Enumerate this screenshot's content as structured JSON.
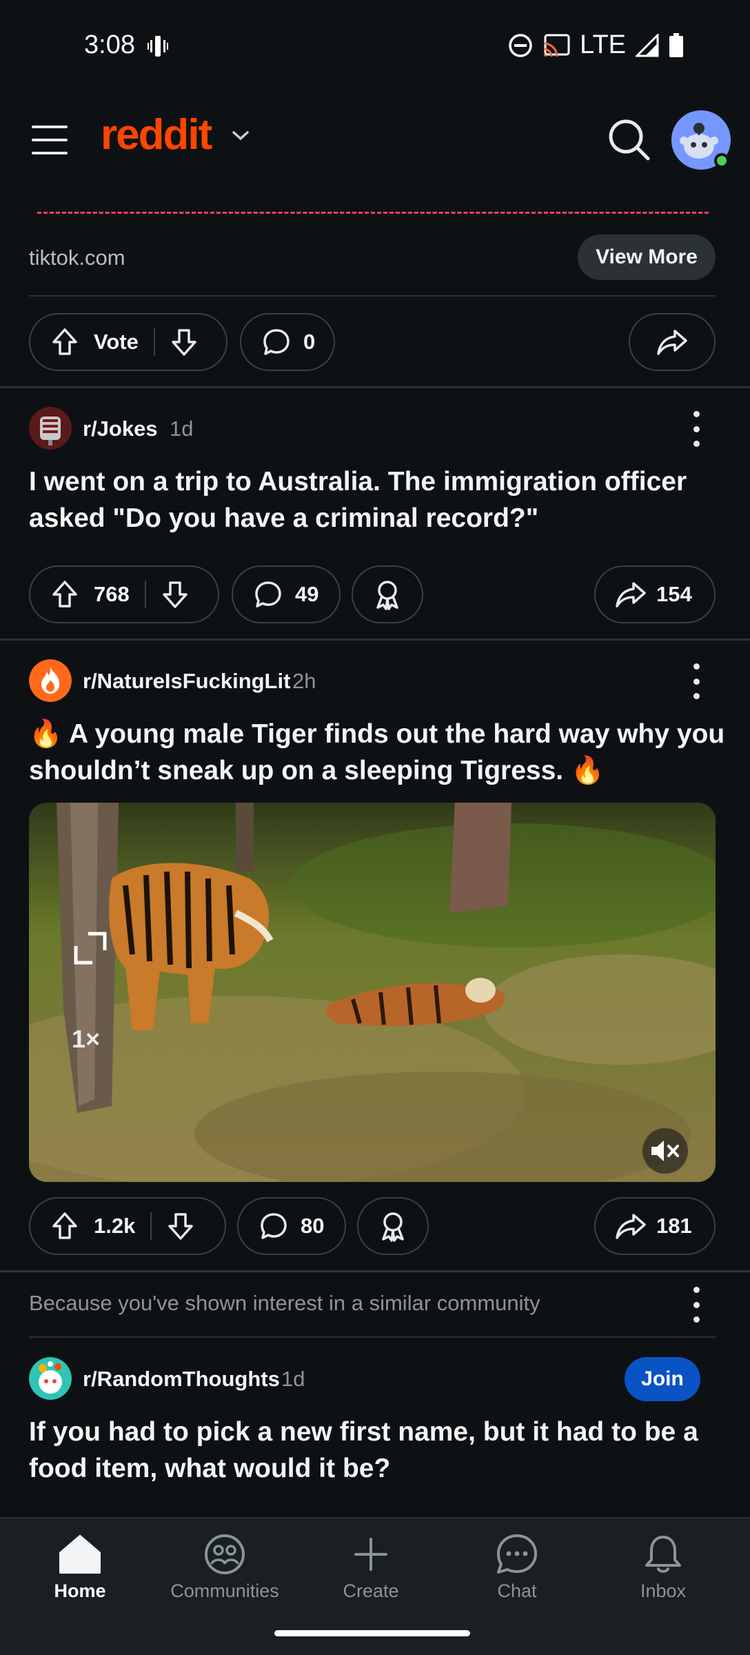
{
  "status_bar": {
    "time": "3:08",
    "network": "LTE",
    "icons": [
      "vibrate-icon",
      "dnd-icon",
      "cast-icon",
      "signal-icon",
      "battery-icon"
    ]
  },
  "header": {
    "logo": "reddit",
    "icons": [
      "menu-icon",
      "chevron-down-icon",
      "search-icon",
      "avatar"
    ]
  },
  "promo_card": {
    "domain": "tiktok.com",
    "view_more": "View More",
    "vote_label": "Vote",
    "comments": "0"
  },
  "posts": [
    {
      "subreddit": "r/Jokes",
      "age": "1d",
      "title": "I went on a trip to Australia. The immigration officer asked \"Do you have a criminal record?\"",
      "upvotes": "768",
      "comments": "49",
      "shares": "154"
    },
    {
      "subreddit": "r/NatureIsFuckingLit",
      "age": "2h",
      "title": "🔥 A young male Tiger finds out the hard way why you shouldn’t sneak up on a sleeping Tigress. 🔥",
      "upvotes": "1.2k",
      "comments": "80",
      "shares": "181",
      "video_speed": "1×"
    }
  ],
  "recommendation": {
    "reason": "Because you've shown interest in a similar community",
    "subreddit": "r/RandomThoughts",
    "age": "1d",
    "join_label": "Join",
    "title": "If you had to pick a new first name, but it had to be a food item, what would it be?"
  },
  "bottom_nav": [
    {
      "label": "Home",
      "icon": "home-icon",
      "active": true
    },
    {
      "label": "Communities",
      "icon": "communities-icon",
      "active": false
    },
    {
      "label": "Create",
      "icon": "plus-icon",
      "active": false
    },
    {
      "label": "Chat",
      "icon": "chat-icon",
      "active": false
    },
    {
      "label": "Inbox",
      "icon": "bell-icon",
      "active": false
    }
  ],
  "colors": {
    "background": "#0e1113",
    "brand": "#ff4500",
    "join": "#0a53c4",
    "online": "#46d160"
  }
}
